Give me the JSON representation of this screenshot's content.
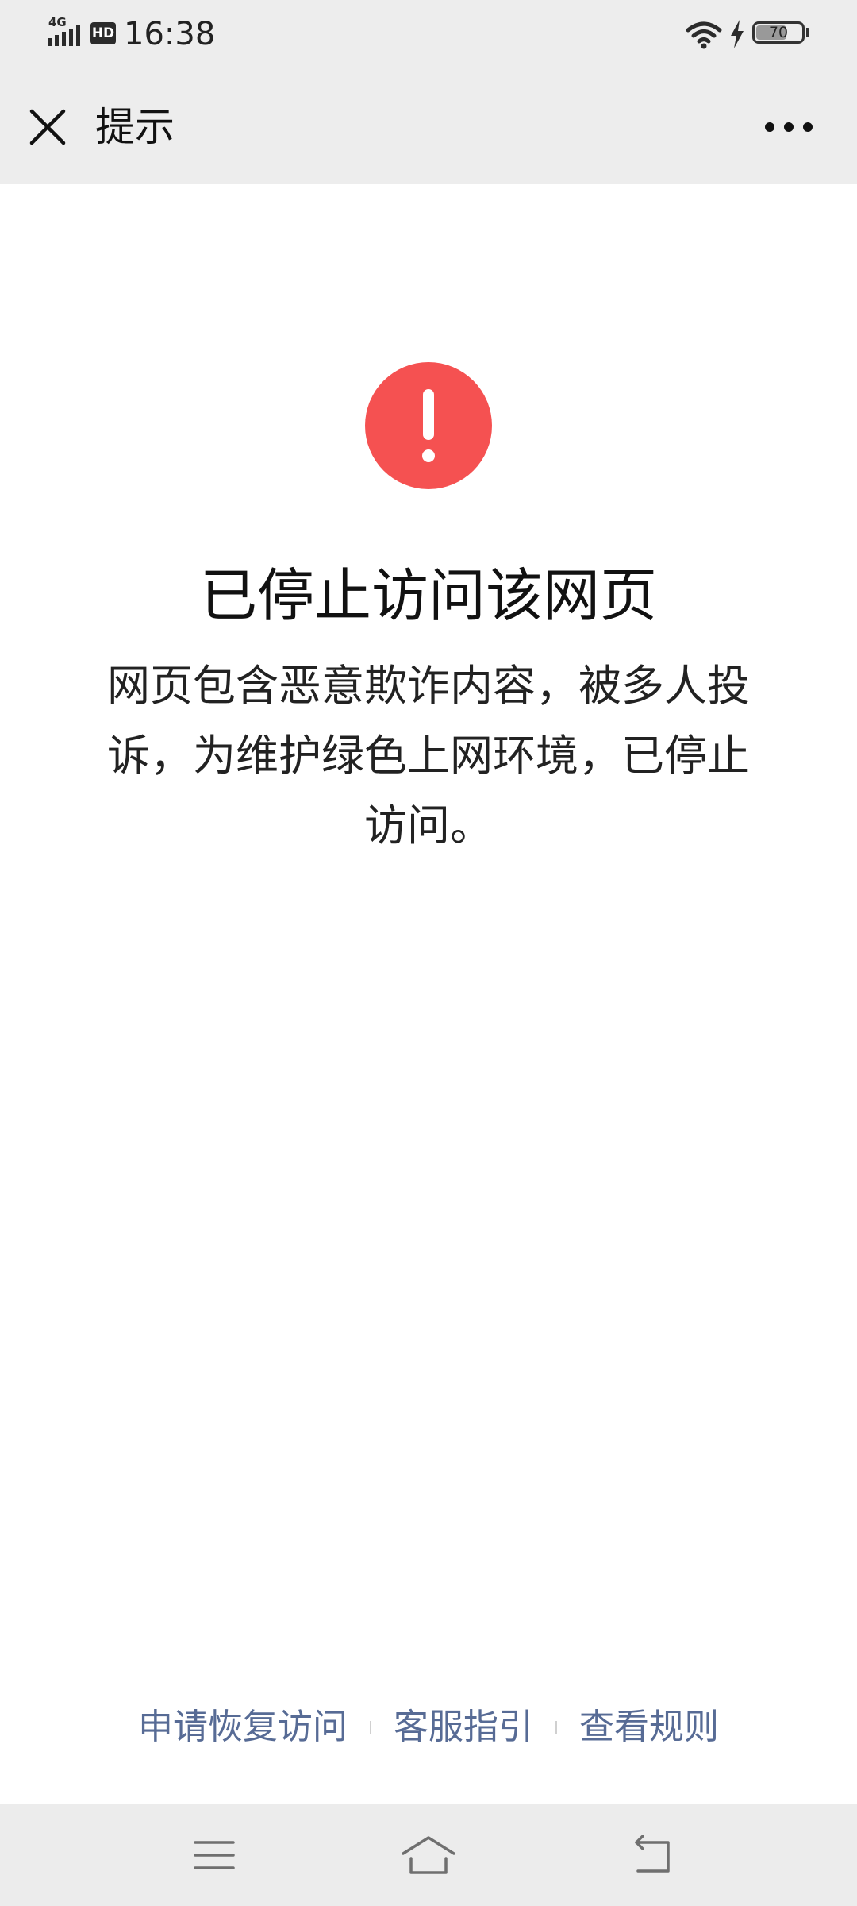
{
  "status_bar": {
    "network": "4G",
    "hd_badge": "HD",
    "time": "16:38",
    "battery_level": 70,
    "battery_text": "70",
    "charging": true
  },
  "nav": {
    "title": "提示",
    "close_icon": "close-icon",
    "more_icon": "more-icon"
  },
  "alert": {
    "icon": "exclamation-circle-icon",
    "icon_color": "#f55151",
    "heading": "已停止访问该网页",
    "message": "网页包含恶意欺诈内容，被多人投诉，为维护绿色上网环境，已停止访问。"
  },
  "footer": {
    "link_color": "#576b95",
    "links": [
      {
        "label": "申请恢复访问"
      },
      {
        "label": "客服指引"
      },
      {
        "label": "查看规则"
      }
    ]
  },
  "system_nav": {
    "menu_icon": "menu-icon",
    "home_icon": "home-icon",
    "back_icon": "back-icon"
  }
}
